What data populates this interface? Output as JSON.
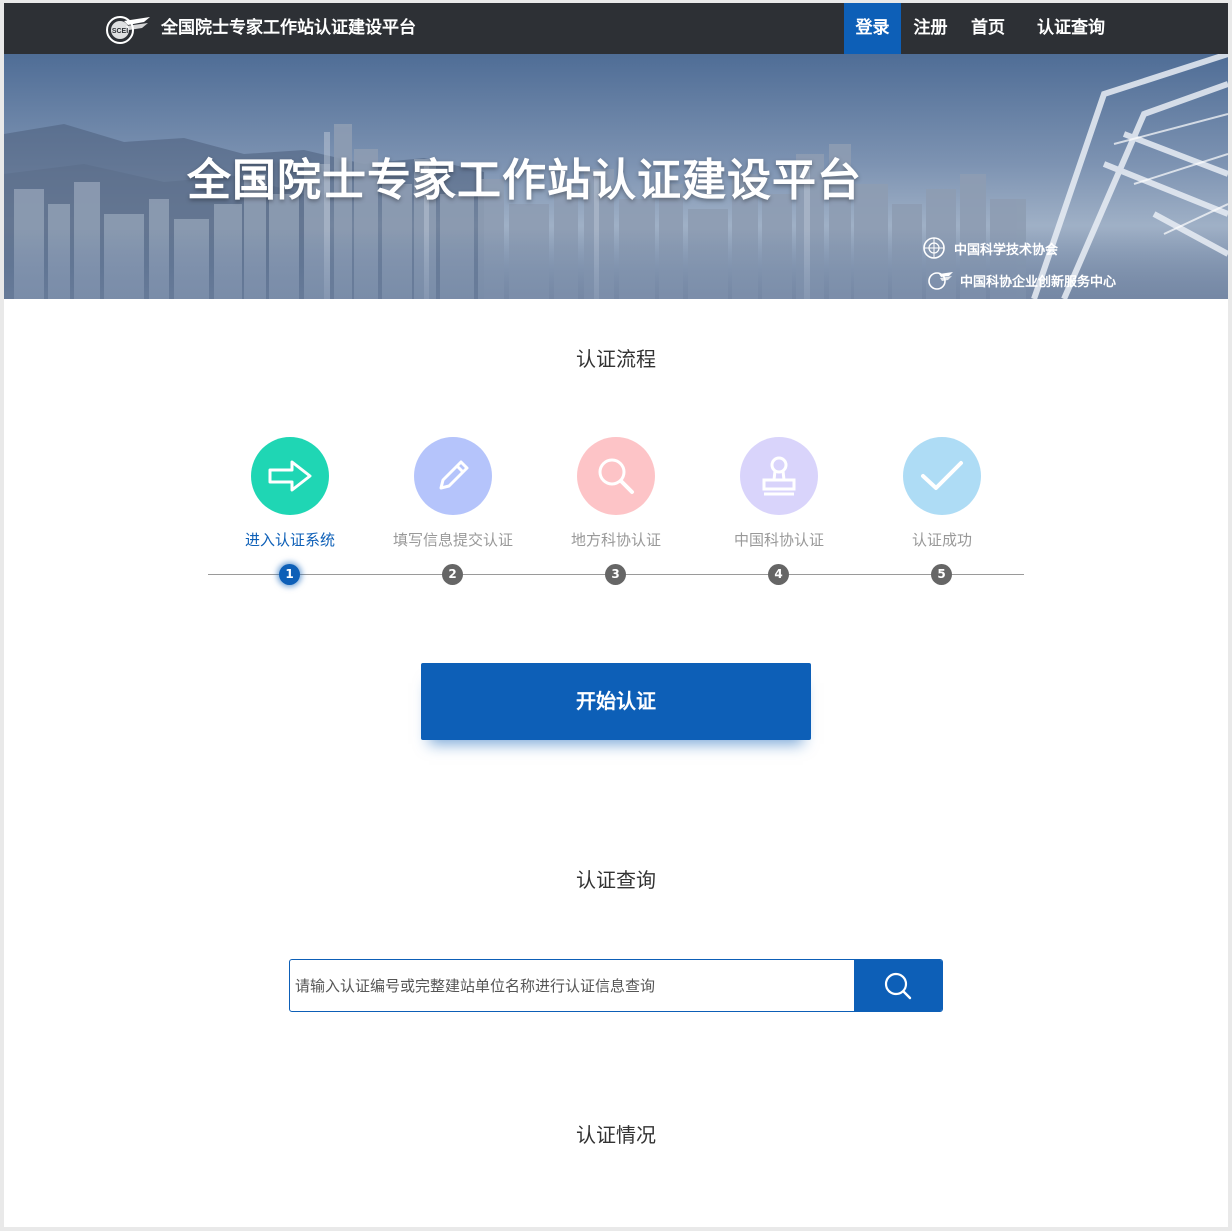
{
  "header": {
    "brand": "全国院士专家工作站认证建设平台",
    "nav": {
      "login": "登录",
      "register": "注册",
      "home": "首页",
      "query": "认证查询"
    }
  },
  "banner": {
    "title": "全国院士专家工作站认证建设平台",
    "orgs": [
      "中国科学技术协会",
      "中国科协企业创新服务中心"
    ]
  },
  "process": {
    "title": "认证流程",
    "steps": [
      {
        "label": "进入认证系统",
        "num": "1",
        "icon": "arrow-right-icon",
        "color": "#1fd6b4",
        "active": true
      },
      {
        "label": "填写信息提交认证",
        "num": "2",
        "icon": "pencil-icon",
        "color": "#b5c4fb",
        "active": false
      },
      {
        "label": "地方科协认证",
        "num": "3",
        "icon": "magnifier-icon",
        "color": "#fdc4c7",
        "active": false
      },
      {
        "label": "中国科协认证",
        "num": "4",
        "icon": "stamp-icon",
        "color": "#d9d4fb",
        "active": false
      },
      {
        "label": "认证成功",
        "num": "5",
        "icon": "checkmark-icon",
        "color": "#aedcf5",
        "active": false
      }
    ],
    "start_button": "开始认证"
  },
  "query": {
    "title": "认证查询",
    "placeholder": "请输入认证编号或完整建站单位名称进行认证信息查询"
  },
  "status": {
    "title": "认证情况"
  },
  "colors": {
    "primary": "#0d5fb7",
    "topbar": "#2d3035"
  }
}
